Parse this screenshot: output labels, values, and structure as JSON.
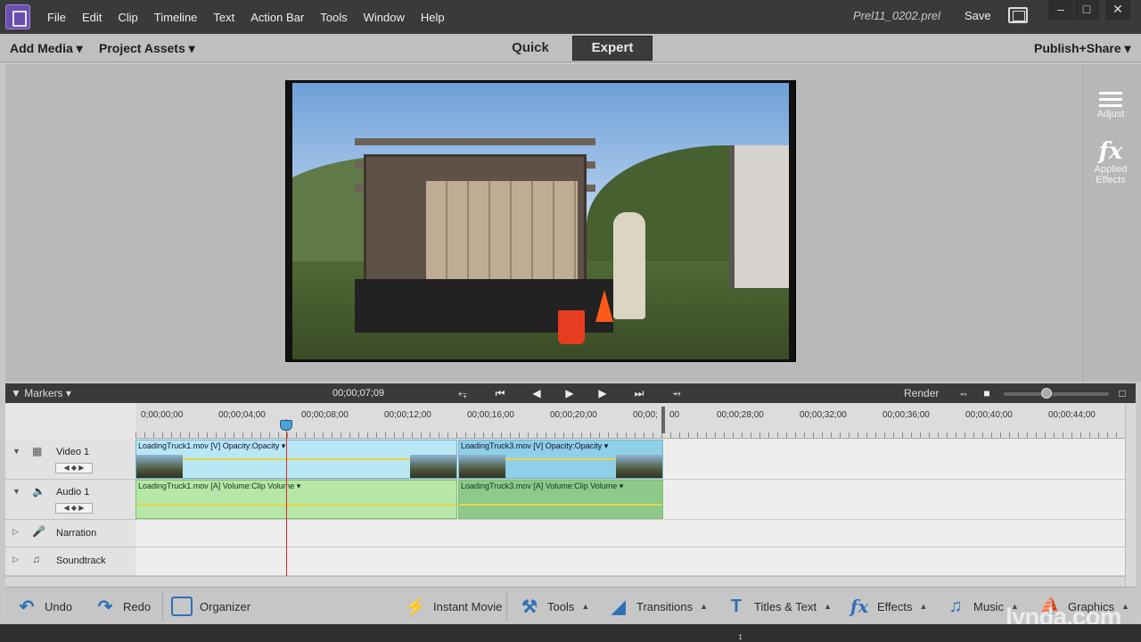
{
  "menu": {
    "items": [
      "File",
      "Edit",
      "Clip",
      "Timeline",
      "Text",
      "Action Bar",
      "Tools",
      "Window",
      "Help"
    ],
    "filename": "Prel11_0202.prel",
    "save": "Save"
  },
  "toolbar": {
    "add_media": "Add Media",
    "project_assets": "Project Assets",
    "quick": "Quick",
    "expert": "Expert",
    "publish": "Publish+Share"
  },
  "right_panel": {
    "adjust": "Adjust",
    "applied_effects_line1": "Applied",
    "applied_effects_line2": "Effects"
  },
  "timeline_bar": {
    "markers": "Markers",
    "timecode": "00;00;07;09",
    "render": "Render"
  },
  "ruler": [
    "0;00;00;00",
    "00;00;04;00",
    "00;00;08;00",
    "00;00;12;00",
    "00;00;16;00",
    "00;00;20;00",
    "00;00;",
    "00",
    "00;00;28;00",
    "00;00;32;00",
    "00;00;36;00",
    "00;00;40;00",
    "00;00;44;00"
  ],
  "tracks": {
    "video1": "Video 1",
    "audio1": "Audio 1",
    "narration": "Narration",
    "soundtrack": "Soundtrack"
  },
  "clips": {
    "v1": "LoadingTruck1.mov [V] Opacity:Opacity ▾",
    "v3": "LoadingTruck3.mov [V] Opacity:Opacity ▾",
    "a1": "LoadingTruck1.mov [A] Volume:Clip Volume ▾",
    "a3": "LoadingTruck3.mov [A] Volume:Clip Volume ▾"
  },
  "actionbar": {
    "undo": "Undo",
    "redo": "Redo",
    "organizer": "Organizer",
    "instant_movie": "Instant Movie",
    "tools": "Tools",
    "transitions": "Transitions",
    "titles_text": "Titles & Text",
    "effects": "Effects",
    "music": "Music",
    "graphics": "Graphics"
  },
  "watermark": "lynda.com"
}
